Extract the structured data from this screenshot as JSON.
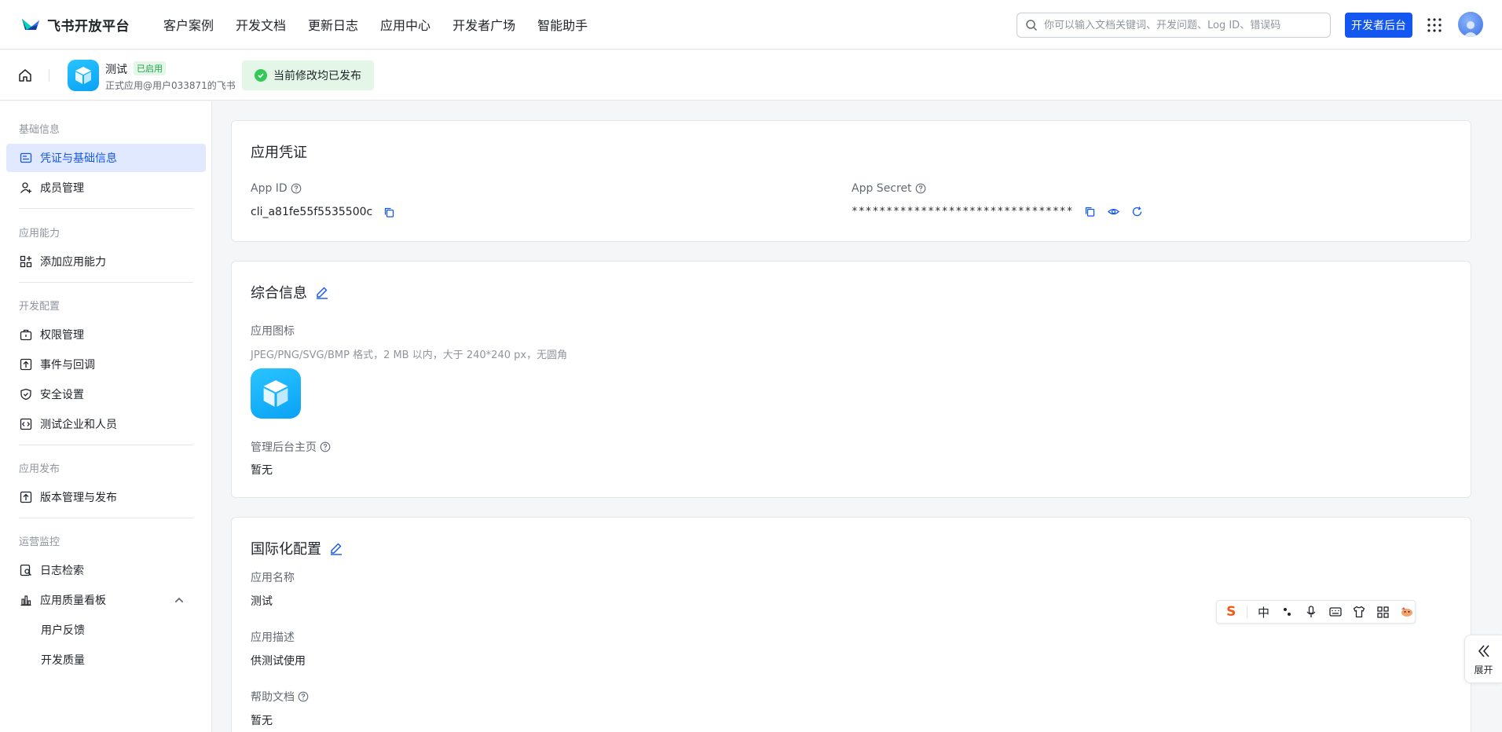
{
  "brand": {
    "name": "飞书开放平台"
  },
  "nav": [
    "客户案例",
    "开发文档",
    "更新日志",
    "应用中心",
    "开发者广场",
    "智能助手"
  ],
  "search": {
    "placeholder": "你可以输入文档关键词、开发问题、Log ID、错误码"
  },
  "header": {
    "dev_console_label": "开发者后台"
  },
  "app": {
    "name": "测试",
    "status": "已启用",
    "subtitle": "正式应用@用户033871的飞书",
    "publish_status": "当前修改均已发布"
  },
  "sidebar": {
    "groups": [
      {
        "title": "基础信息",
        "items": [
          "凭证与基础信息",
          "成员管理"
        ]
      },
      {
        "title": "应用能力",
        "items": [
          "添加应用能力"
        ]
      },
      {
        "title": "开发配置",
        "items": [
          "权限管理",
          "事件与回调",
          "安全设置",
          "测试企业和人员"
        ]
      },
      {
        "title": "应用发布",
        "items": [
          "版本管理与发布"
        ]
      },
      {
        "title": "运营监控",
        "items": [
          "日志检索",
          "应用质量看板",
          "用户反馈",
          "开发质量"
        ]
      }
    ]
  },
  "credentials": {
    "title": "应用凭证",
    "app_id_label": "App ID",
    "app_id": "cli_a81fe55f5535500c",
    "app_secret_label": "App Secret",
    "app_secret": "********************************"
  },
  "general": {
    "title": "综合信息",
    "icon_label": "应用图标",
    "icon_hint": "JPEG/PNG/SVG/BMP 格式，2 MB 以内，大于 240*240 px，无圆角",
    "homepage_label": "管理后台主页",
    "homepage_value": "暂无"
  },
  "i18n": {
    "title": "国际化配置",
    "name_label": "应用名称",
    "name_value": "测试",
    "desc_label": "应用描述",
    "desc_value": "供测试使用",
    "help_label": "帮助文档",
    "help_value": "暂无"
  },
  "ime_toolbar": {
    "lang": "中"
  },
  "expand": {
    "label": "展开"
  },
  "colors": {
    "primary": "#1456f0",
    "success": "#34c759",
    "app_icon": "#0aa2f5"
  }
}
